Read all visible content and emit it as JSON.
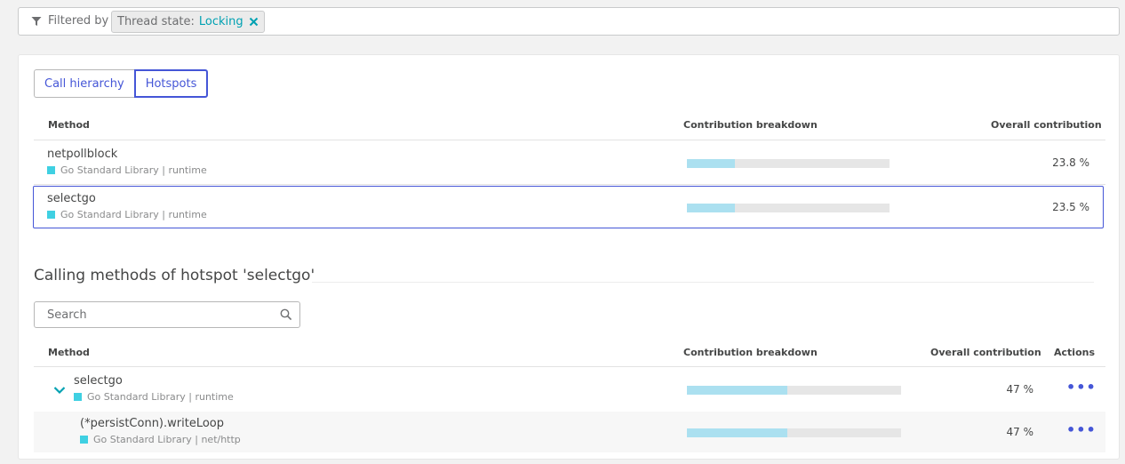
{
  "filter": {
    "label": "Filtered by",
    "chip_key": "Thread state:",
    "chip_value": "Locking"
  },
  "tabs": [
    {
      "label": "Call hierarchy",
      "active": false
    },
    {
      "label": "Hotspots",
      "active": true
    }
  ],
  "hotspots_table": {
    "headers": {
      "method": "Method",
      "breakdown": "Contribution breakdown",
      "overall": "Overall contribution"
    },
    "rows": [
      {
        "name": "netpollblock",
        "library": "Go Standard Library | runtime",
        "contribution": "23.8 %",
        "value": 23.8,
        "selected": false
      },
      {
        "name": "selectgo",
        "library": "Go Standard Library | runtime",
        "contribution": "23.5 %",
        "value": 23.5,
        "selected": true
      }
    ]
  },
  "calling": {
    "title": "Calling methods of hotspot 'selectgo'",
    "search_placeholder": "Search",
    "headers": {
      "method": "Method",
      "breakdown": "Contribution breakdown",
      "overall": "Overall contribution",
      "actions": "Actions"
    },
    "rows": [
      {
        "name": "selectgo",
        "library": "Go Standard Library | runtime",
        "contribution": "47 %",
        "value": 47,
        "expanded": true
      },
      {
        "name": "(*persistConn).writeLoop",
        "library": "Go Standard Library | net/http",
        "contribution": "47 %",
        "value": 47
      }
    ],
    "actions_glyph": "•••"
  },
  "colors": {
    "accent": "#4556d7",
    "teal": "#00a1b2",
    "bar_fill": "#abe0f0",
    "library_square": "#3fd0e2"
  },
  "icons": [
    "filter-icon",
    "close-icon",
    "search-icon",
    "chevron-down-icon",
    "more-actions-icon"
  ]
}
